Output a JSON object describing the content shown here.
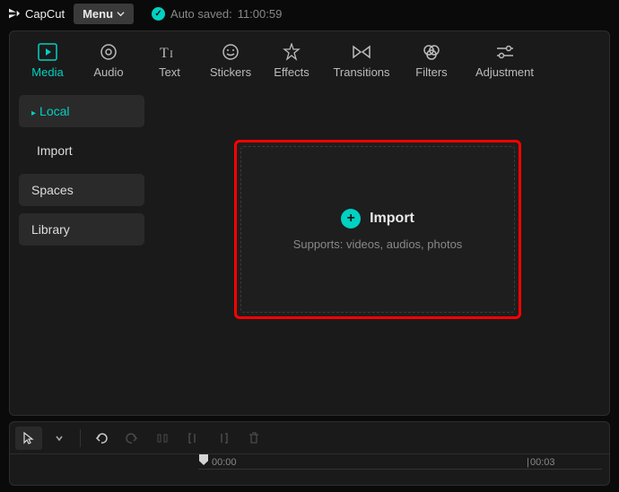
{
  "app": {
    "name": "CapCut"
  },
  "header": {
    "menu_label": "Menu",
    "autosave_prefix": "Auto saved: ",
    "autosave_time": "11:00:59"
  },
  "tabs": [
    {
      "key": "media",
      "label": "Media",
      "icon": "media-icon",
      "active": true
    },
    {
      "key": "audio",
      "label": "Audio",
      "icon": "audio-icon"
    },
    {
      "key": "text",
      "label": "Text",
      "icon": "text-icon"
    },
    {
      "key": "stickers",
      "label": "Stickers",
      "icon": "stickers-icon"
    },
    {
      "key": "effects",
      "label": "Effects",
      "icon": "effects-icon"
    },
    {
      "key": "transitions",
      "label": "Transitions",
      "icon": "transitions-icon"
    },
    {
      "key": "filters",
      "label": "Filters",
      "icon": "filters-icon"
    },
    {
      "key": "adjustment",
      "label": "Adjustment",
      "icon": "adjustment-icon"
    }
  ],
  "sidebar": {
    "items": [
      {
        "label": "Local",
        "active": true,
        "expandable": true
      },
      {
        "label": "Import"
      },
      {
        "label": "Spaces"
      },
      {
        "label": "Library"
      }
    ]
  },
  "dropzone": {
    "import_label": "Import",
    "supports_text": "Supports: videos, audios, photos"
  },
  "timeline": {
    "timecodes": [
      "00:00",
      "00:03"
    ]
  },
  "colors": {
    "accent": "#00d1c1",
    "highlight": "#ff0000",
    "panel": "#1a1a1a"
  }
}
